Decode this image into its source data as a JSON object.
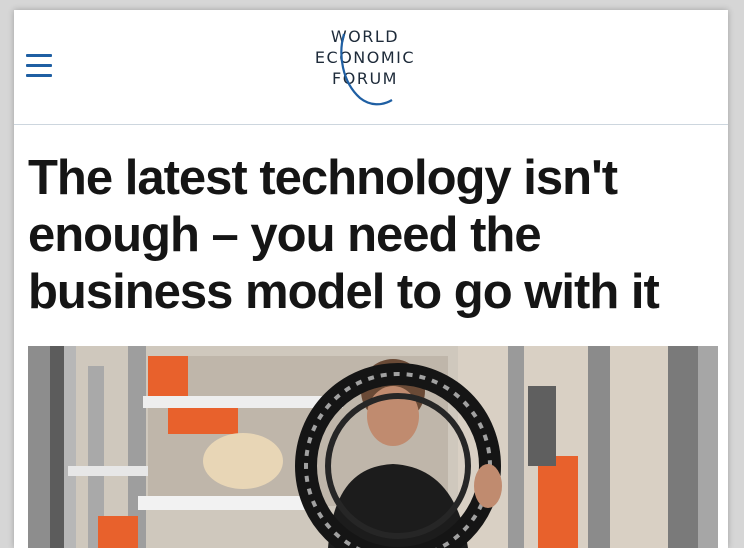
{
  "header": {
    "menu_icon": "hamburger-menu-icon",
    "logo": {
      "line1": "WORLD",
      "line2": "ECONOMIC",
      "line3": "FORUM"
    }
  },
  "article": {
    "headline": "The latest technology isn't enough – you need the business model to go with it"
  },
  "colors": {
    "accent": "#1f5fa3",
    "headline": "#151515",
    "divider": "#cdd6de",
    "orange": "#e8612c"
  }
}
